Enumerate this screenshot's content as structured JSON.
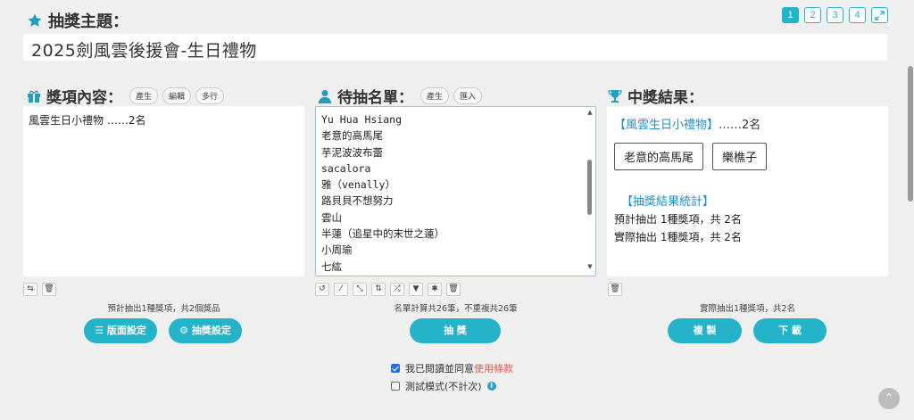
{
  "topic": {
    "label": "抽獎主題：",
    "value": "2025劍風雲後援會-生日禮物"
  },
  "pager": [
    "1",
    "2",
    "3",
    "4"
  ],
  "prizes": {
    "title": "獎項內容：",
    "buttons": [
      "產生",
      "編輯",
      "多行"
    ],
    "content": "風雲生日小禮物 ……2名",
    "summary": "預計抽出1種獎項，共2個獎品"
  },
  "entrants": {
    "title": "待抽名單：",
    "buttons": [
      "產生",
      "匯入"
    ],
    "names": [
      "Yu Hua Hsiang",
      "老意的高馬尾",
      "芋泥波波布蕾",
      "sacalora",
      "雅（venally）",
      "路貝貝不想努力",
      "雲山",
      "半蓮（追星中的末世之蓮）",
      "小周瑜",
      "七紘"
    ],
    "summary": "名單計算共26筆，不重複共26筆"
  },
  "result": {
    "title": "中獎結果：",
    "prize_name": "【風雲生日小禮物】",
    "prize_count": "……2名",
    "winners": [
      "老意的高馬尾",
      "樂樵子"
    ],
    "stats_title": "【抽獎結果統計】",
    "expected": "預計抽出 1種獎項，共 2名",
    "actual": "實際抽出 1種獎項，共 2名",
    "summary": "實際抽出1種獎項，共2名"
  },
  "actions": {
    "layout_settings": "版面設定",
    "draw_settings": "抽獎設定",
    "draw": "抽 獎",
    "copy": "複 製",
    "download": "下 載"
  },
  "agree": {
    "prefix": "我已閱讀並同意",
    "link": "使用條款",
    "checked": true
  },
  "test_mode": {
    "label": "測試模式(不計次)",
    "checked": false
  },
  "colors": {
    "accent": "#24b3c9",
    "link": "#1d8fc9",
    "terms": "#e0574a"
  }
}
